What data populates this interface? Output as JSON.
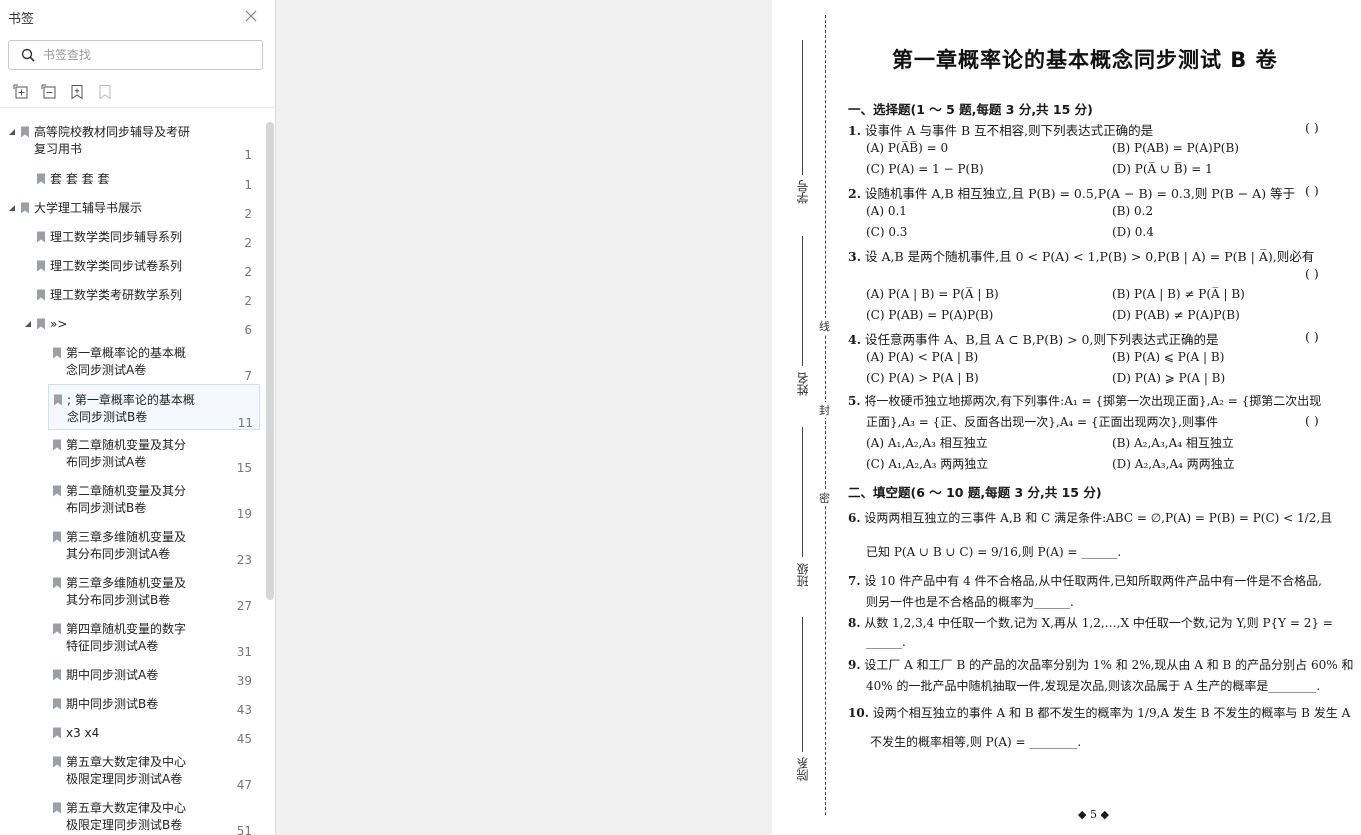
{
  "sidebar": {
    "title": "书签",
    "search_placeholder": "书签查找",
    "items": [
      {
        "label": "高等院校教材同步辅导及考研",
        "label2": "复习用书",
        "page": "1"
      },
      {
        "label": "套 套 套 套",
        "page": "1"
      },
      {
        "label": "大学理工辅导书展示",
        "page": "2"
      },
      {
        "label": "理工数学类同步辅导系列",
        "page": "2"
      },
      {
        "label": "理工数学类同步试卷系列",
        "page": "2"
      },
      {
        "label": "理工数学类考研数学系列",
        "page": "2"
      },
      {
        "label": "»>",
        "page": "6"
      },
      {
        "label": "第一章概率论的基本概",
        "label2": "念同步测试A卷",
        "page": "7"
      },
      {
        "label": "; 第一章概率论的基本概",
        "label2": "念同步测试B卷",
        "page": "11"
      },
      {
        "label": "第二章随机变量及其分",
        "label2": "布同步测试A卷",
        "page": "15"
      },
      {
        "label": "第二章随机变量及其分",
        "label2": "布同步测试B卷",
        "page": "19"
      },
      {
        "label": "第三章多维随机变量及",
        "label2": "其分布同步测试A卷",
        "page": "23"
      },
      {
        "label": "第三章多维随机变量及",
        "label2": "其分布同步测试B卷",
        "page": "27"
      },
      {
        "label": "第四章随机变量的数字",
        "label2": "特征同步测试A卷",
        "page": "31"
      },
      {
        "label": "期中同步测试A卷",
        "page": "39"
      },
      {
        "label": "期中同步测试B卷",
        "page": "43"
      },
      {
        "label": "x3 x4",
        "page": "45"
      },
      {
        "label": "第五章大数定律及中心",
        "label2": "极限定理同步测试A卷",
        "page": "47"
      },
      {
        "label": "第五章大数定律及中心",
        "label2": "极限定理同步测试B卷",
        "page": "51"
      }
    ]
  },
  "doc": {
    "margin_labels": {
      "xuehao": "学号",
      "xingming": "姓名",
      "banji": "班级",
      "yuanxi": "院系"
    },
    "margin_marks": {
      "xian": "线",
      "feng": "封",
      "mi": "密"
    },
    "title": "第一章概率论的基本概念同步测试 B 卷",
    "sec1": "一、选择题(1 ～ 5 题,每题 3 分,共 15 分)",
    "q1": "设事件 A 与事件 B 互不相容,则下列表达式正确的是",
    "q1a": "(A) P(A̅B̅) = 0",
    "q1b": "(B) P(AB) = P(A)P(B)",
    "q1c": "(C) P(A) = 1 − P(B)",
    "q1d": "(D) P(A̅ ∪ B̅) = 1",
    "q2": "设随机事件 A,B 相互独立,且 P(B) = 0.5,P(A − B) = 0.3,则 P(B − A) 等于",
    "q2a": "(A) 0.1",
    "q2b": "(B) 0.2",
    "q2c": "(C) 0.3",
    "q2d": "(D) 0.4",
    "q3": "设 A,B 是两个随机事件,且 0 < P(A) < 1,P(B) > 0,P(B | A) = P(B | A̅),则必有",
    "q3a": "(A) P(A | B) = P(A̅ | B)",
    "q3b": "(B) P(A | B) ≠ P(A̅ | B)",
    "q3c": "(C) P(AB) = P(A)P(B)",
    "q3d": "(D) P(AB) ≠ P(A)P(B)",
    "q4": "设任意两事件 A、B,且 A ⊂ B,P(B) > 0,则下列表达式正确的是",
    "q4a": "(A) P(A) < P(A | B)",
    "q4b": "(B) P(A) ⩽ P(A | B)",
    "q4c": "(C) P(A) > P(A | B)",
    "q4d": "(D) P(A) ⩾ P(A | B)",
    "q5": "将一枚硬币独立地掷两次,有下列事件:A₁ = {掷第一次出现正面},A₂ = {掷第二次出现",
    "q5b": "正面},A₃ = {正、反面各出现一次},A₄ = {正面出现两次},则事件",
    "q5oa": "(A) A₁,A₂,A₃ 相互独立",
    "q5ob": "(B) A₂,A₃,A₄ 相互独立",
    "q5oc": "(C) A₁,A₂,A₃ 两两独立",
    "q5od": "(D) A₂,A₃,A₄ 两两独立",
    "sec2": "二、填空题(6 ～ 10 题,每题 3 分,共 15 分)",
    "q6": "设两两相互独立的三事件 A,B 和 C 满足条件:ABC = ∅,P(A) = P(B) = P(C) < 1/2,且",
    "q6b": "已知 P(A ∪ B ∪ C) = 9/16,则 P(A) = ______.",
    "q7": "设 10 件产品中有 4 件不合格品,从中任取两件,已知所取两件产品中有一件是不合格品,",
    "q7b": "则另一件也是不合格品的概率为______.",
    "q8": "从数 1,2,3,4 中任取一个数,记为 X,再从 1,2,…,X 中任取一个数,记为 Y,则 P{Y = 2} =",
    "q8b": "______.",
    "q9": "设工厂 A 和工厂 B 的产品的次品率分别为 1% 和 2%,现从由 A 和 B 的产品分别占 60% 和",
    "q9b": "40% 的一批产品中随机抽取一件,发现是次品,则该次品属于 A 生产的概率是________.",
    "q10": "设两个相互独立的事件 A 和 B 都不发生的概率为 1/9,A 发生 B 不发生的概率与 B 发生 A",
    "q10b": "不发生的概率相等,则 P(A) = ________.",
    "paren": "(    )",
    "n1": "1.",
    "n2": "2.",
    "n3": "3.",
    "n4": "4.",
    "n5": "5.",
    "n6": "6.",
    "n7": "7.",
    "n8": "8.",
    "n9": "9.",
    "n10": "10.",
    "page_number": "◆ 5 ◆"
  }
}
